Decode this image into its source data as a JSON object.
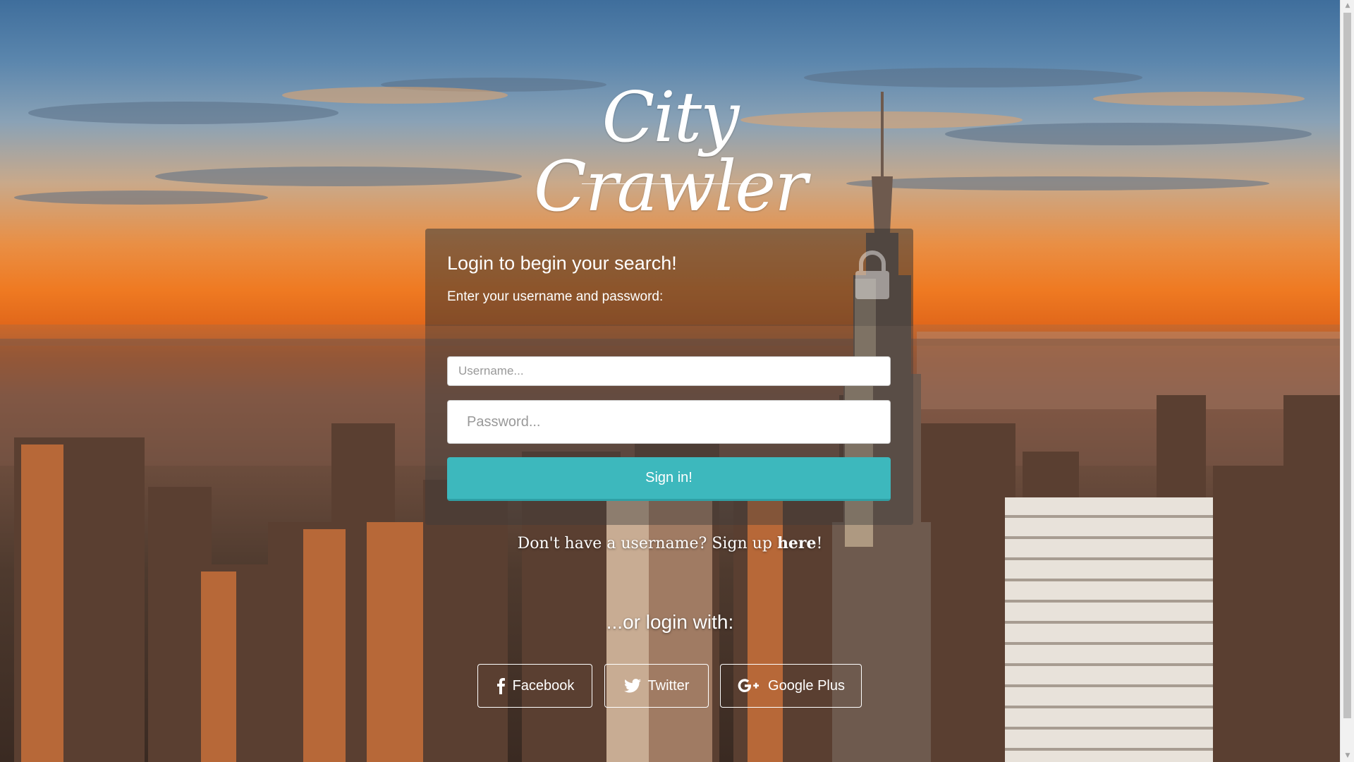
{
  "brand": {
    "title": "City Crawler"
  },
  "login": {
    "title": "Login to begin your search!",
    "subtitle": "Enter your username and password:",
    "username_placeholder": "Username...",
    "password_placeholder": "Password...",
    "signin_label": "Sign in!",
    "lock_icon": "lock-icon"
  },
  "signup": {
    "prefix": "Don't have a username? Sign up ",
    "link_text": "here",
    "suffix": "!"
  },
  "social": {
    "heading": "...or login with:",
    "buttons": [
      {
        "label": "Facebook",
        "icon": "facebook-icon"
      },
      {
        "label": "Twitter",
        "icon": "twitter-icon"
      },
      {
        "label": "Google Plus",
        "icon": "google-plus-icon"
      }
    ]
  },
  "colors": {
    "accent": "#3db8bd",
    "text": "#ffffff",
    "panel": "rgba(60,60,60,0.42)"
  }
}
